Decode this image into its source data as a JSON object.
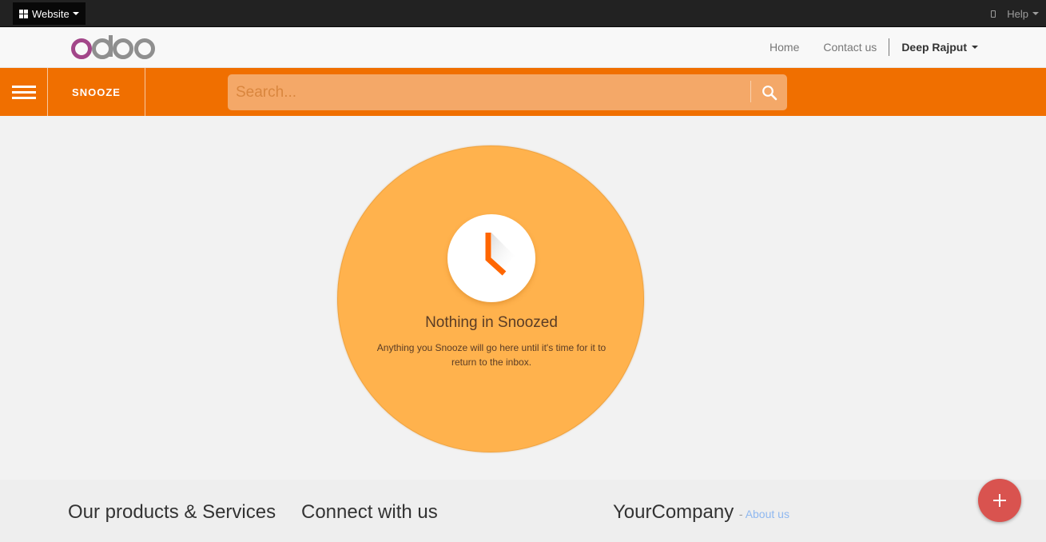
{
  "adminbar": {
    "website_label": "Website",
    "help_label": "Help",
    "icons": {
      "website": "grid-icon",
      "mobile": "mobile-preview-icon",
      "help_caret": "caret-down-icon"
    }
  },
  "header": {
    "logo_text": "odoo",
    "nav": {
      "home": "Home",
      "contact": "Contact us",
      "user": "Deep Rajput"
    }
  },
  "appbar": {
    "title": "SNOOZE",
    "search_placeholder": "Search...",
    "search_value": "",
    "icons": {
      "menu": "hamburger-icon",
      "search": "search-icon"
    }
  },
  "empty_state": {
    "icon": "clock-icon",
    "title": "Nothing in Snoozed",
    "description": "Anything you Snooze will go here until it's time for it to return to the inbox."
  },
  "footer": {
    "col1_title": "Our products & Services",
    "col2_title": "Connect with us",
    "company": "YourCompany",
    "about_prefix": "-",
    "about_link": "About us"
  },
  "fab": {
    "icon": "plus-icon",
    "label": "+"
  },
  "colors": {
    "appbar": "#f06f00",
    "circle": "#ffb24d",
    "clock_hand": "#ff6600",
    "fab": "#d9534f",
    "logo_o": "#a24689",
    "logo_doo": "#8f8f8f"
  }
}
